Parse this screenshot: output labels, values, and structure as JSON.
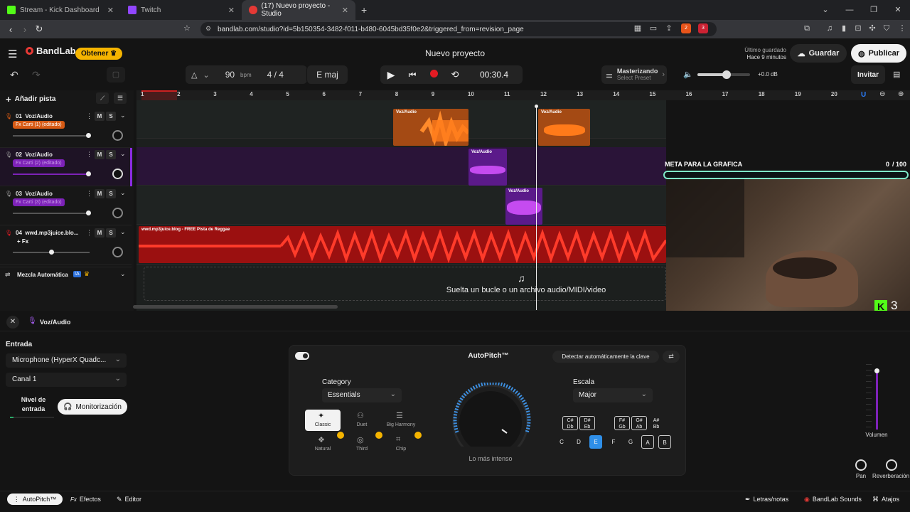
{
  "browser": {
    "tabs": [
      {
        "label": "Stream - Kick Dashboard"
      },
      {
        "label": "Twitch"
      },
      {
        "label": "(17) Nuevo proyecto - Studio"
      }
    ],
    "new_tab": "+",
    "url": "bandlab.com/studio?id=5b150354-3482-f011-b480-6045bd35f0e2&triggered_from=revision_page",
    "ext_badge_1": "2",
    "ext_badge_2": "3"
  },
  "app": {
    "logo": "BandLab",
    "obtener": "Obtener",
    "project_title": "Nuevo proyecto",
    "last_saved_label": "Último guardado",
    "last_saved_time": "Hace 9 minutos",
    "guardar": "Guardar",
    "publicar": "Publicar",
    "invitar": "Invitar"
  },
  "transport": {
    "tempo": "90",
    "bpm": "bpm",
    "time_sig": "4 / 4",
    "key": "E maj",
    "time": "00:30.4",
    "mastering": "Masterizando",
    "preset": "Select Preset",
    "gain": "+0.0 dB",
    "volume_level": 0.55
  },
  "tracks_panel": {
    "add_track": "Añadir pista",
    "tracks": [
      {
        "num": "01",
        "name": "Voz/Audio",
        "fx": "Fx Carti (1) (editado)",
        "fx_color": "#d65a14",
        "vol": 0.98
      },
      {
        "num": "02",
        "name": "Voz/Audio",
        "fx": "Fx Carti (2) (editado)",
        "fx_color": "#7d22b8",
        "vol": 0.98
      },
      {
        "num": "03",
        "name": "Voz/Audio",
        "fx": "Fx Carti (3) (editado)",
        "fx_color": "#3a3a3a",
        "vol": 0.98
      },
      {
        "num": "04",
        "name": "wwd.mp3juice.blo...",
        "fx": "+ Fx",
        "fx_color": "transparent",
        "vol": 0.5
      }
    ],
    "m": "M",
    "s": "S",
    "automix": "Mezcla Automática",
    "ia": "IA"
  },
  "timeline": {
    "bars": [
      "1",
      "2",
      "3",
      "4",
      "5",
      "6",
      "7",
      "8",
      "9",
      "10",
      "11",
      "12",
      "13",
      "14",
      "15",
      "16",
      "17",
      "18",
      "19",
      "20"
    ],
    "clip_label": "Voz/Audio",
    "track4_label": "wwd.mp3juice.blog - FREE Pista de Reggae",
    "drop_text": "Suelta un bucle o un archivo audio/MIDI/video"
  },
  "overlay": {
    "goal_label": "META PARA LA GRAFICA",
    "goal_current": "0",
    "goal_total": "/ 100",
    "goal_progress": 0,
    "kick_count": "3"
  },
  "editor": {
    "track_name": "Voz/Audio",
    "entrada": "Entrada",
    "mic": "Microphone (HyperX Quadc...",
    "canal": "Canal 1",
    "nivel": "Nivel de entrada",
    "monitor": "Monitorización",
    "autopitch_title": "AutoPitch™",
    "detect_key": "Detectar automáticamente la clave",
    "category_label": "Category",
    "category_value": "Essentials",
    "styles": [
      {
        "label": "Classic"
      },
      {
        "label": "Duet"
      },
      {
        "label": "Big Harmony"
      },
      {
        "label": "Natural"
      },
      {
        "label": "Third"
      },
      {
        "label": "Chip"
      }
    ],
    "intensity_label": "Lo más intenso",
    "scale_label": "Escala",
    "scale_value": "Major",
    "sharps": [
      {
        "top": "C#",
        "bot": "Db"
      },
      {
        "top": "D#",
        "bot": "Eb"
      },
      {
        "top": "F#",
        "bot": "Gb"
      },
      {
        "top": "G#",
        "bot": "Ab"
      },
      {
        "top": "A#",
        "bot": "Bb"
      }
    ],
    "naturals": [
      "C",
      "D",
      "E",
      "F",
      "G",
      "A",
      "B"
    ],
    "volumen": "Volumen",
    "pan": "Pan",
    "reverb": "Reverberación"
  },
  "footer": {
    "autopitch": "AutoPitch™",
    "efectos": "Efectos",
    "editor": "Editor",
    "letras": "Letras/notas",
    "sounds": "BandLab Sounds",
    "atajos": "Atajos"
  }
}
